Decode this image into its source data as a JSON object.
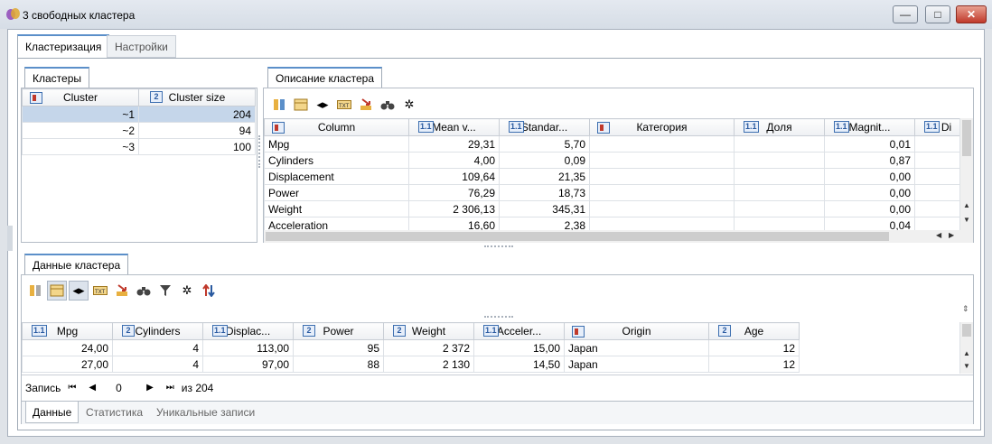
{
  "window": {
    "title": "3 свободных кластера",
    "minimize": "—",
    "maximize": "□",
    "close": "✕"
  },
  "main_tabs": [
    {
      "label": "Кластеризация",
      "active": true
    },
    {
      "label": "Настройки",
      "active": false
    }
  ],
  "clusters_panel": {
    "tab_label": "Кластеры",
    "columns": [
      {
        "label": "Cluster",
        "type": "icon"
      },
      {
        "label": "Cluster size",
        "type": "2"
      }
    ],
    "rows": [
      {
        "cluster": "~1",
        "size": "204",
        "selected": true
      },
      {
        "cluster": "~2",
        "size": "94",
        "selected": false
      },
      {
        "cluster": "~3",
        "size": "100",
        "selected": false
      }
    ]
  },
  "description_panel": {
    "tab_label": "Описание кластера",
    "toolbar_icons": [
      "columns-icon",
      "table-icon",
      "fit-width-icon",
      "text-icon",
      "export-icon",
      "binoculars-icon",
      "settings-icon"
    ],
    "columns": [
      {
        "label": "Column",
        "type": "icon"
      },
      {
        "label": "Mean v...",
        "type": "1.1"
      },
      {
        "label": "Standar...",
        "type": "1.1"
      },
      {
        "label": "Категория",
        "type": "icon"
      },
      {
        "label": "Доля",
        "type": "1.1"
      },
      {
        "label": "Magnit...",
        "type": "1.1"
      },
      {
        "label": "Di",
        "type": "1.1"
      }
    ],
    "rows": [
      [
        "Mpg",
        "29,31",
        "5,70",
        "",
        "",
        "0,01"
      ],
      [
        "Cylinders",
        "4,00",
        "0,09",
        "",
        "",
        "0,87"
      ],
      [
        "Displacement",
        "109,64",
        "21,35",
        "",
        "",
        "0,00"
      ],
      [
        "Power",
        "76,29",
        "18,73",
        "",
        "",
        "0,00"
      ],
      [
        "Weight",
        "2 306,13",
        "345,31",
        "",
        "",
        "0,00"
      ],
      [
        "Acceleration",
        "16,60",
        "2,38",
        "",
        "",
        "0,04"
      ]
    ]
  },
  "data_panel": {
    "tab_label": "Данные кластера",
    "toolbar_icons": [
      "columns-icon",
      "table-icon",
      "fit-width-icon",
      "text-icon",
      "export-icon",
      "binoculars-icon",
      "filter-icon",
      "settings-icon",
      "sort-icon"
    ],
    "columns": [
      {
        "label": "Mpg",
        "type": "1.1"
      },
      {
        "label": "Cylinders",
        "type": "2"
      },
      {
        "label": "Displac...",
        "type": "1.1"
      },
      {
        "label": "Power",
        "type": "2"
      },
      {
        "label": "Weight",
        "type": "2"
      },
      {
        "label": "Acceler...",
        "type": "1.1"
      },
      {
        "label": "Origin",
        "type": "icon"
      },
      {
        "label": "Age",
        "type": "2"
      }
    ],
    "rows": [
      [
        "24,00",
        "4",
        "113,00",
        "95",
        "2 372",
        "15,00",
        "Japan",
        "12"
      ],
      [
        "27,00",
        "4",
        "97,00",
        "88",
        "2 130",
        "14,50",
        "Japan",
        "12"
      ]
    ],
    "navigator": {
      "label": "Запись",
      "current": "0",
      "of_label": "из 204"
    },
    "bottom_tabs": [
      {
        "label": "Данные",
        "active": true
      },
      {
        "label": "Статистика",
        "active": false
      },
      {
        "label": "Уникальные записи",
        "active": false
      }
    ]
  }
}
